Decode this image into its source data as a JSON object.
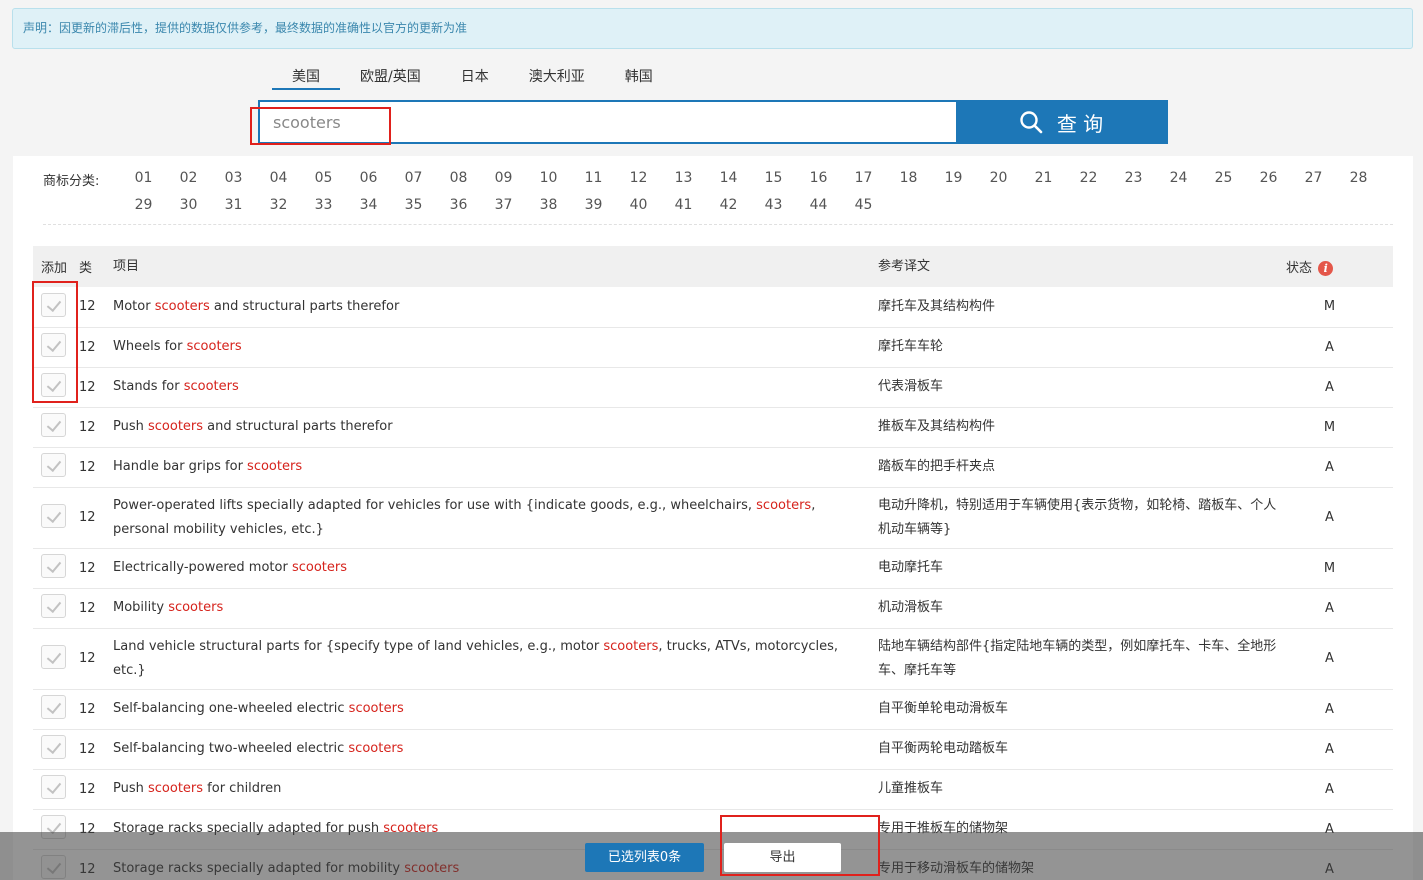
{
  "notice": "声明：因更新的滞后性，提供的数据仅供参考，最终数据的准确性以官方的更新为准",
  "tabs": [
    "美国",
    "欧盟/英国",
    "日本",
    "澳大利亚",
    "韩国"
  ],
  "search": {
    "value": "scooters",
    "button_label": "查 询"
  },
  "classes_label": "商标分类:",
  "classes": [
    "01",
    "02",
    "03",
    "04",
    "05",
    "06",
    "07",
    "08",
    "09",
    "10",
    "11",
    "12",
    "13",
    "14",
    "15",
    "16",
    "17",
    "18",
    "19",
    "20",
    "21",
    "22",
    "23",
    "24",
    "25",
    "26",
    "27",
    "28",
    "29",
    "30",
    "31",
    "32",
    "33",
    "34",
    "35",
    "36",
    "37",
    "38",
    "39",
    "40",
    "41",
    "42",
    "43",
    "44",
    "45"
  ],
  "table": {
    "headers": {
      "add": "添加",
      "cls": "类",
      "item": "项目",
      "translation": "参考译文",
      "status": "状态",
      "status_icon": "info-icon"
    },
    "keyword": "scooters",
    "rows": [
      {
        "cls": "12",
        "pre": "Motor ",
        "post": " and structural parts therefor",
        "tr": "摩托车及其结构构件",
        "status": "M"
      },
      {
        "cls": "12",
        "pre": "Wheels for ",
        "post": "",
        "tr": "摩托车车轮",
        "status": "A"
      },
      {
        "cls": "12",
        "pre": "Stands for ",
        "post": "",
        "tr": "代表滑板车",
        "status": "A"
      },
      {
        "cls": "12",
        "pre": "Push ",
        "post": " and structural parts therefor",
        "tr": "推板车及其结构构件",
        "status": "M"
      },
      {
        "cls": "12",
        "pre": "Handle bar grips for ",
        "post": "",
        "tr": "踏板车的把手杆夹点",
        "status": "A"
      },
      {
        "cls": "12",
        "pre": "Power-operated lifts specially adapted for vehicles for use with {indicate goods, e.g., wheelchairs, ",
        "post": ", personal mobility vehicles, etc.}",
        "tr": "电动升降机，特别适用于车辆使用{表示货物，如轮椅、踏板车、个人机动车辆等}",
        "status": "A",
        "tall": true
      },
      {
        "cls": "12",
        "pre": "Electrically-powered motor ",
        "post": "",
        "tr": "电动摩托车",
        "status": "M"
      },
      {
        "cls": "12",
        "pre": "Mobility ",
        "post": "",
        "tr": "机动滑板车",
        "status": "A"
      },
      {
        "cls": "12",
        "pre": "Land vehicle structural parts for {specify type of land vehicles, e.g., motor ",
        "post": ", trucks, ATVs, motorcycles, etc.}",
        "tr": "陆地车辆结构部件{指定陆地车辆的类型，例如摩托车、卡车、全地形车、摩托车等",
        "status": "A",
        "tall": true
      },
      {
        "cls": "12",
        "pre": "Self-balancing one-wheeled electric ",
        "post": "",
        "tr": "自平衡单轮电动滑板车",
        "status": "A"
      },
      {
        "cls": "12",
        "pre": "Self-balancing two-wheeled electric ",
        "post": "",
        "tr": "自平衡两轮电动踏板车",
        "status": "A"
      },
      {
        "cls": "12",
        "pre": "Push ",
        "post": " for children",
        "tr": "儿童推板车",
        "status": "A"
      },
      {
        "cls": "12",
        "pre": "Storage racks specially adapted for push ",
        "post": "",
        "tr": "专用于推板车的储物架",
        "status": "A"
      },
      {
        "cls": "12",
        "pre": "Storage racks specially adapted for mobility ",
        "post": "",
        "tr": "专用于移动滑板车的储物架",
        "status": "A"
      }
    ]
  },
  "bottom": {
    "selected_label": "已选列表0条",
    "export_label": "导出"
  },
  "colors": {
    "accent": "#1d77b7",
    "keyword": "#d6231c",
    "highlight_box": "#e0211c"
  }
}
